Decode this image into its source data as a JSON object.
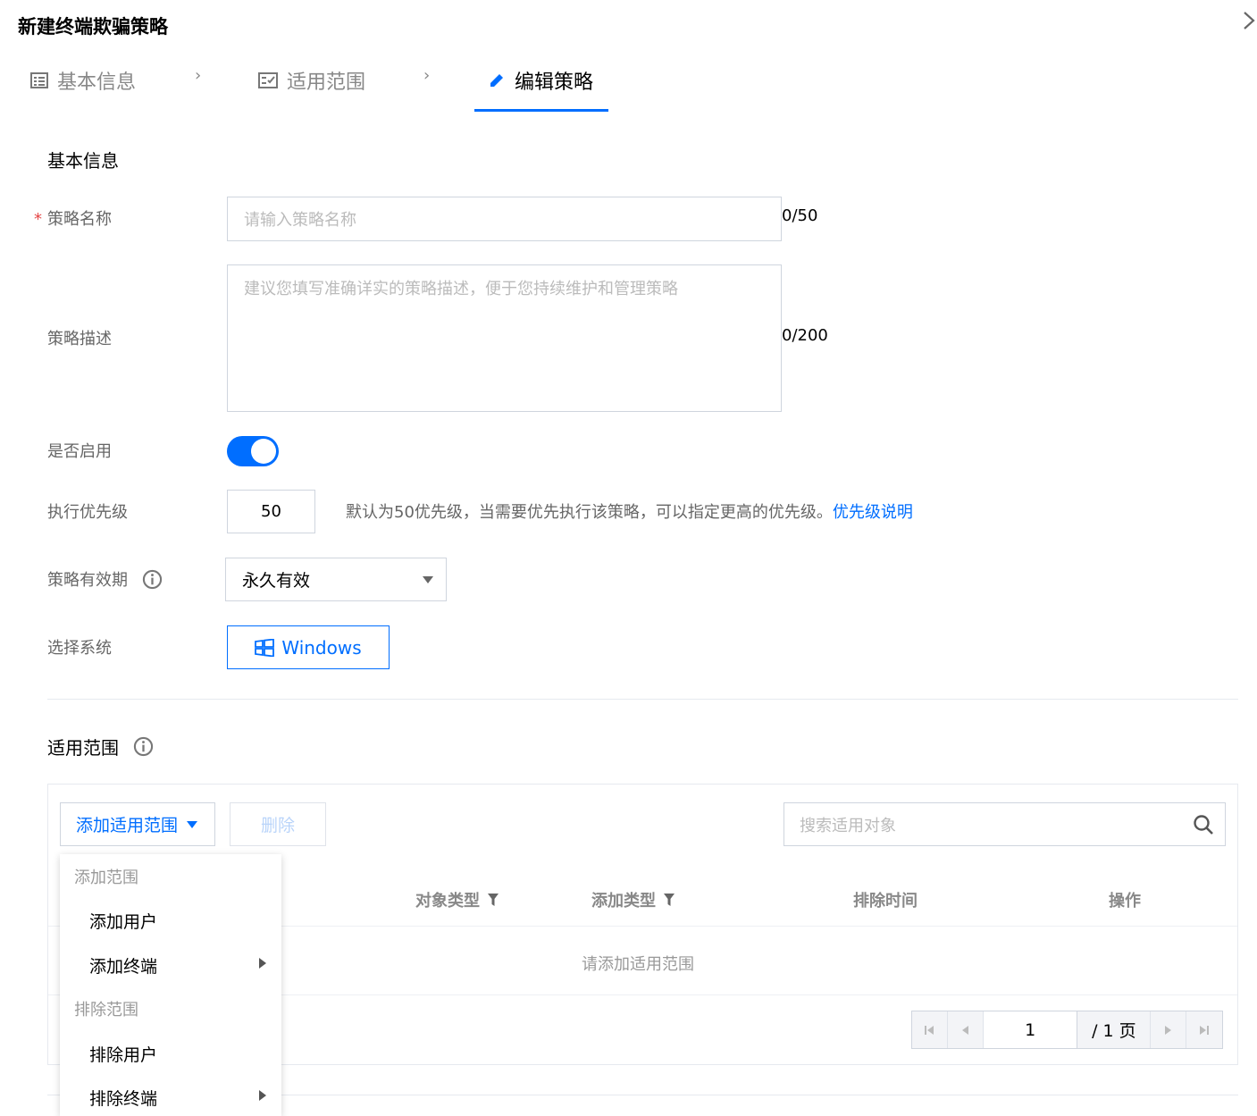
{
  "dialog": {
    "title": "新建终端欺骗策略",
    "close_icon": "×"
  },
  "steps": [
    {
      "label": "基本信息",
      "icon": "list-icon"
    },
    {
      "label": "适用范围",
      "icon": "range-icon"
    },
    {
      "label": "编辑策略",
      "icon": "edit-icon",
      "active": true
    }
  ],
  "step_separator": "›",
  "basic": {
    "section_title": "基本信息",
    "name_label": "策略名称",
    "name_required": "*",
    "name_placeholder": "请输入策略名称",
    "name_counter": "0/50",
    "desc_label": "策略描述",
    "desc_placeholder": "建议您填写准确详实的策略描述，便于您持续维护和管理策略",
    "desc_counter": "0/200",
    "enable_label": "是否启用",
    "enabled": true,
    "priority_label": "执行优先级",
    "priority_value": "50",
    "priority_hint": "默认为50优先级，当需要优先执行该策略，可以指定更高的优先级。",
    "priority_link": "优先级说明",
    "validity_label": "策略有效期",
    "validity_value": "永久有效",
    "system_label": "选择系统",
    "system_value": "Windows"
  },
  "scope": {
    "section_title": "适用范围",
    "add_button": "添加适用范围",
    "delete_button": "删除",
    "search_placeholder": "搜索适用对象",
    "columns": [
      "对象类型",
      "添加类型",
      "排除时间",
      "操作"
    ],
    "empty_text": "请添加适用范围",
    "pager": {
      "current": "1",
      "total": "/ 1 页"
    }
  },
  "dropdown": {
    "groups": [
      {
        "title": "添加范围",
        "items": [
          {
            "label": "添加用户",
            "submenu": false
          },
          {
            "label": "添加终端",
            "submenu": true
          }
        ]
      },
      {
        "title": "排除范围",
        "items": [
          {
            "label": "排除用户",
            "submenu": false
          },
          {
            "label": "排除终端",
            "submenu": true
          }
        ]
      }
    ]
  },
  "colors": {
    "primary": "#006eff",
    "required": "#e54545"
  }
}
